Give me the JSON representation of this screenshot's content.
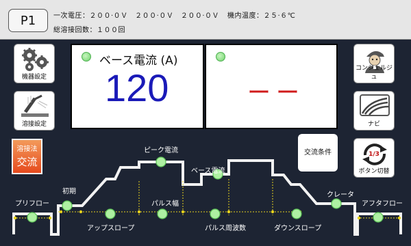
{
  "header": {
    "program": "P1",
    "voltage_label": "一次電圧：",
    "voltages": "２００·０Ｖ　２００·０Ｖ　２００·０Ｖ",
    "temp_label": "機内温度：",
    "temp_value": "２５·６℃",
    "weld_count_label": "総溶接回数：",
    "weld_count_value": "１００回"
  },
  "left_buttons": {
    "equipment_settings": "機器設定",
    "weld_settings": "溶接設定"
  },
  "right_buttons": {
    "concierge": "コンシェルジュ",
    "navi": "ナビ",
    "button_switch": "ボタン切替",
    "page_indicator": "1/3"
  },
  "display": {
    "left_label": "ベース電流 (A)",
    "left_value": "120",
    "right_value": "ーー"
  },
  "mode": {
    "label": "溶接法",
    "value": "交流"
  },
  "ac_conditions_button": "交流条件",
  "waveform": {
    "preflow": "プリフロー",
    "initial": "初期",
    "upslope": "アップスロープ",
    "peak_current": "ピーク電流",
    "pulse_width": "パルス幅",
    "base_current": "ベース電流",
    "pulse_frequency": "パルス周波数",
    "downslope": "ダウンスロープ",
    "crater": "クレータ",
    "afterflow": "アフタフロー"
  },
  "colors": {
    "background": "#1d2433",
    "led_green": "#6fd36a",
    "value_blue": "#1a1ab8",
    "dash_red": "#d01a1a",
    "mode_orange": "#e64a1e",
    "marker_yellow": "#e7d21c"
  }
}
